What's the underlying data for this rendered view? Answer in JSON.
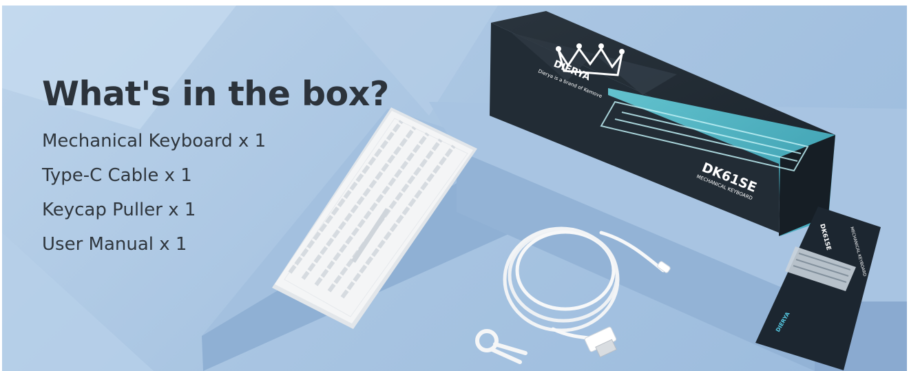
{
  "banner": {
    "headline": "What's in the box?",
    "items": [
      "Mechanical Keyboard x 1",
      "Type-C Cable x 1",
      "Keycap Puller x 1",
      "User Manual x 1"
    ]
  },
  "box": {
    "brand": "DIERYA",
    "tagline": "Dierya is a brand of Kemove",
    "model": "DK61SE",
    "subtitle": "MECHANICAL KEYBOARD"
  },
  "manual": {
    "model": "DK61SE",
    "subtitle": "MECHANICAL KEYBOARD",
    "brand": "DIERYA"
  },
  "colors": {
    "background": "#a9c5e2",
    "headline": "#2c333b",
    "box_dark": "#1f2a33",
    "box_accent": "#54c4d2",
    "keyboard": "#f4f5f6"
  },
  "icons": [
    "crown-logo-icon"
  ]
}
